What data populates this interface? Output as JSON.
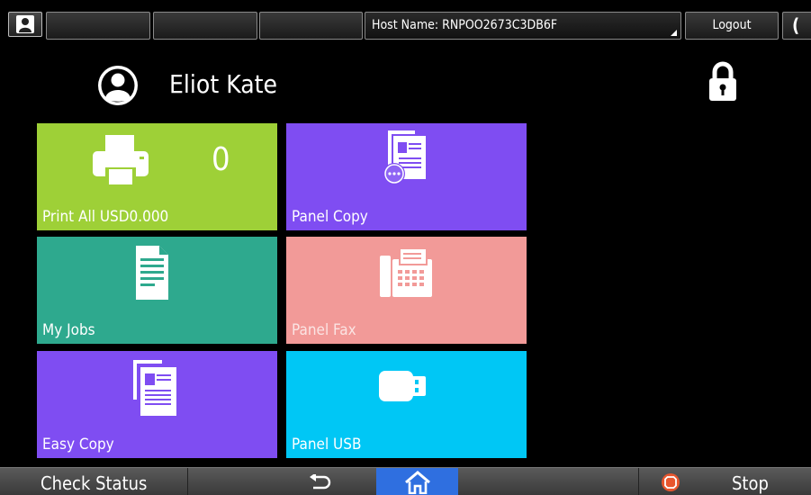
{
  "topbar": {
    "host_name": "Host Name: RNPOO2673C3DB6F",
    "logout_label": "Logout",
    "moon_glyph": "(",
    "icons": [
      "user-icon",
      "moon-icon"
    ]
  },
  "header": {
    "user_name": "Eliot Kate",
    "icons": [
      "avatar-icon",
      "lock-icon"
    ]
  },
  "tiles": [
    {
      "label": "Print All USD0.000",
      "count": "0",
      "color": "#9ed037",
      "icon": "printer-icon"
    },
    {
      "label": "Panel Copy",
      "color": "#7f4df2",
      "icon": "panel-copy-icon"
    },
    {
      "label": "My Jobs",
      "color": "#2ea98e",
      "icon": "document-icon"
    },
    {
      "label": "Panel Fax",
      "color": "#f29a98",
      "icon": "fax-icon"
    },
    {
      "label": "Easy Copy",
      "color": "#7f4df2",
      "icon": "copy-icon"
    },
    {
      "label": "Panel USB",
      "color": "#00c7f5",
      "icon": "usb-icon"
    }
  ],
  "bottombar": {
    "check_status_label": "Check Status",
    "stop_label": "Stop",
    "home_color": "#2f6fe0",
    "stop_color": "#e8562e",
    "icons": [
      "back-icon",
      "home-icon",
      "stop-icon"
    ]
  }
}
